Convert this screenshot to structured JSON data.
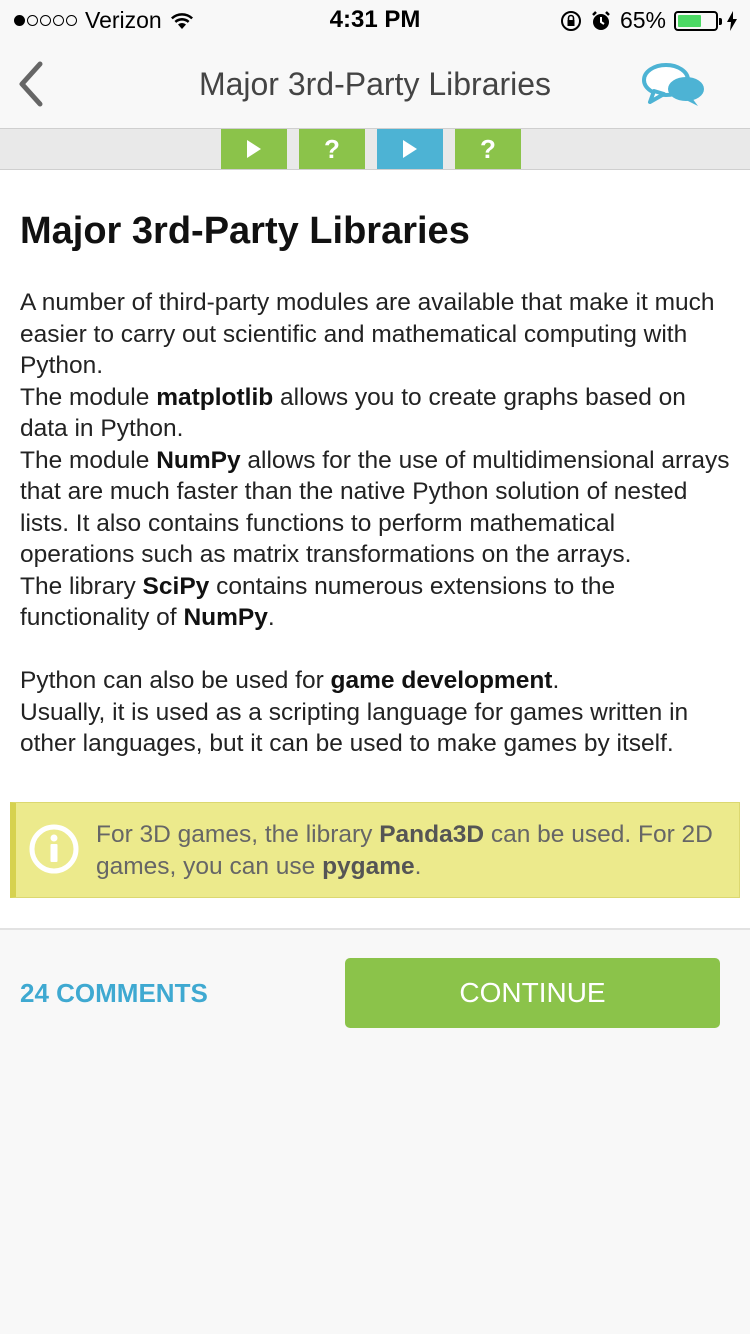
{
  "status_bar": {
    "carrier": "Verizon",
    "time": "4:31 PM",
    "battery_percent": "65%",
    "battery_level": 0.65,
    "signal_bars": 1
  },
  "nav": {
    "title": "Major 3rd-Party Libraries",
    "back_icon": "chevron-left-icon",
    "chat_icon": "chat-bubbles-icon"
  },
  "lesson_tabs": [
    {
      "type": "play",
      "color": "#8bc34a"
    },
    {
      "type": "quiz",
      "label": "?",
      "color": "#8bc34a"
    },
    {
      "type": "play",
      "color": "#4db3d4",
      "active": true
    },
    {
      "type": "quiz",
      "label": "?",
      "color": "#8bc34a"
    }
  ],
  "content": {
    "title": "Major 3rd-Party Libraries",
    "p1": "A number of third-party modules are available that make it much easier to carry out scientific and mathematical computing with Python.",
    "p2_pre": "The module ",
    "p2_bold": "matplotlib",
    "p2_post": " allows you to create graphs based on data in Python.",
    "p3_pre": "The module ",
    "p3_bold": "NumPy",
    "p3_post": " allows for the use of multidimensional arrays that are much faster than the native Python solution of nested lists. It also contains functions to perform mathematical operations such as matrix transformations on the arrays.",
    "p4_pre": "The library ",
    "p4_bold1": "SciPy",
    "p4_mid": " contains numerous extensions to the functionality of ",
    "p4_bold2": "NumPy",
    "p4_post": ".",
    "p5_pre": "Python can also be used for ",
    "p5_bold": "game development",
    "p5_post": ".",
    "p6": "Usually, it is used as a scripting language for games written in other languages, but it can be used to make games by itself."
  },
  "info": {
    "icon": "info-icon",
    "pre": "For 3D games, the library ",
    "bold1": "Panda3D",
    "mid": " can be used. For 2D games, you can use ",
    "bold2": "pygame",
    "post": "."
  },
  "footer": {
    "comments_label": "24 COMMENTS",
    "continue_label": "CONTINUE"
  },
  "colors": {
    "accent_green": "#8bc34a",
    "accent_blue": "#4db3d4",
    "link_blue": "#3fa9d1",
    "info_bg": "#ecea8c"
  }
}
